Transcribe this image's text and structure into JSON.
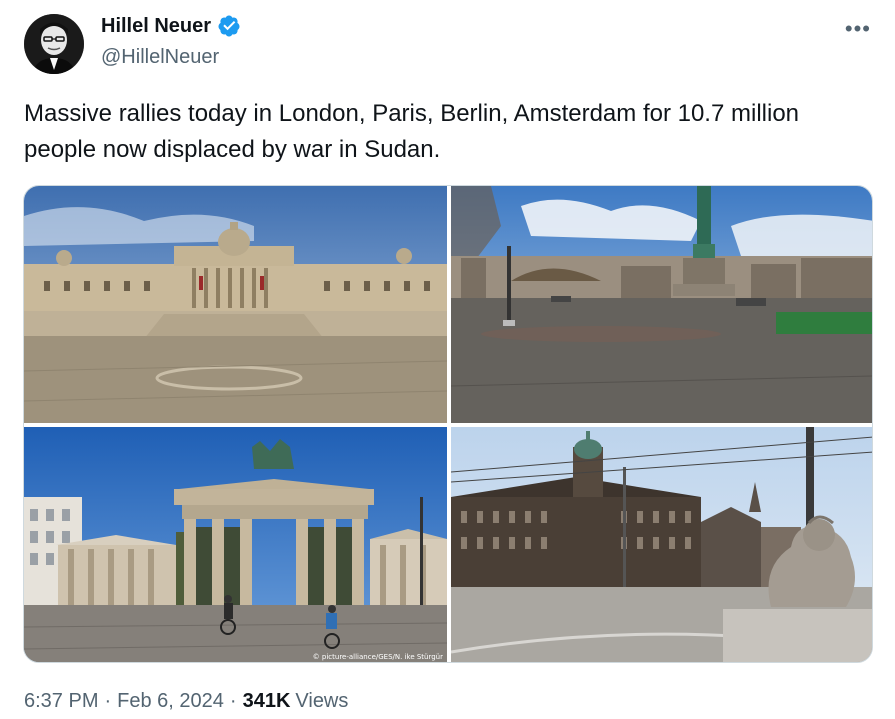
{
  "author": {
    "name": "Hillel Neuer",
    "handle": "@HillelNeuer",
    "verified": true,
    "avatar_icon": "avatar-portrait-icon"
  },
  "more_label": "•••",
  "tweet": {
    "text": "Massive rallies today in London, Paris, Berlin, Amsterdam for 10.7 million people now displaced by war in Sudan."
  },
  "media": {
    "photo_credit": "© picture-alliance/GES/N. ike Stürgür"
  },
  "meta": {
    "time": "6:37 PM",
    "date": "Feb 6, 2024",
    "views_count": "341K",
    "views_label": "Views",
    "separator": "·"
  },
  "colors": {
    "verified_blue": "#1d9bf0",
    "secondary_text": "#536471",
    "primary_text": "#0f1419"
  }
}
